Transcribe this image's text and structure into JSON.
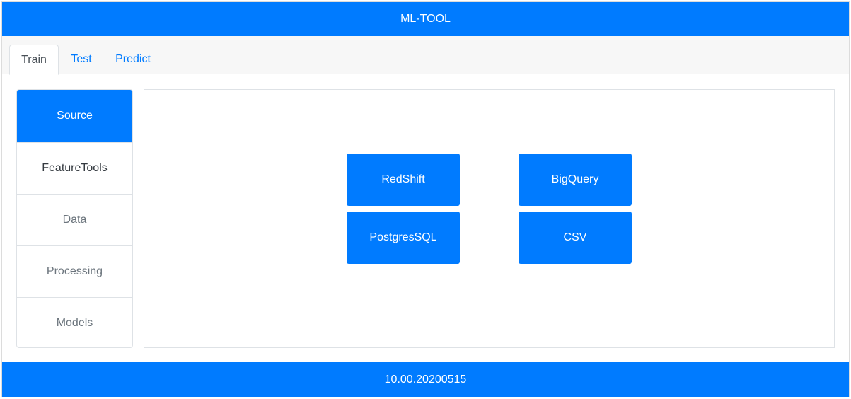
{
  "header": {
    "title": "ML-TOOL"
  },
  "tabs": [
    {
      "label": "Train"
    },
    {
      "label": "Test"
    },
    {
      "label": "Predict"
    }
  ],
  "sidebar": {
    "items": [
      {
        "label": "Source"
      },
      {
        "label": "FeatureTools"
      },
      {
        "label": "Data"
      },
      {
        "label": "Processing"
      },
      {
        "label": "Models"
      }
    ]
  },
  "sources": [
    {
      "label": "RedShift"
    },
    {
      "label": "BigQuery"
    },
    {
      "label": "PostgresSQL"
    },
    {
      "label": "CSV"
    }
  ],
  "footer": {
    "version": "10.00.20200515"
  },
  "colors": {
    "primary": "#007bff",
    "muted_text": "#6c757d"
  }
}
